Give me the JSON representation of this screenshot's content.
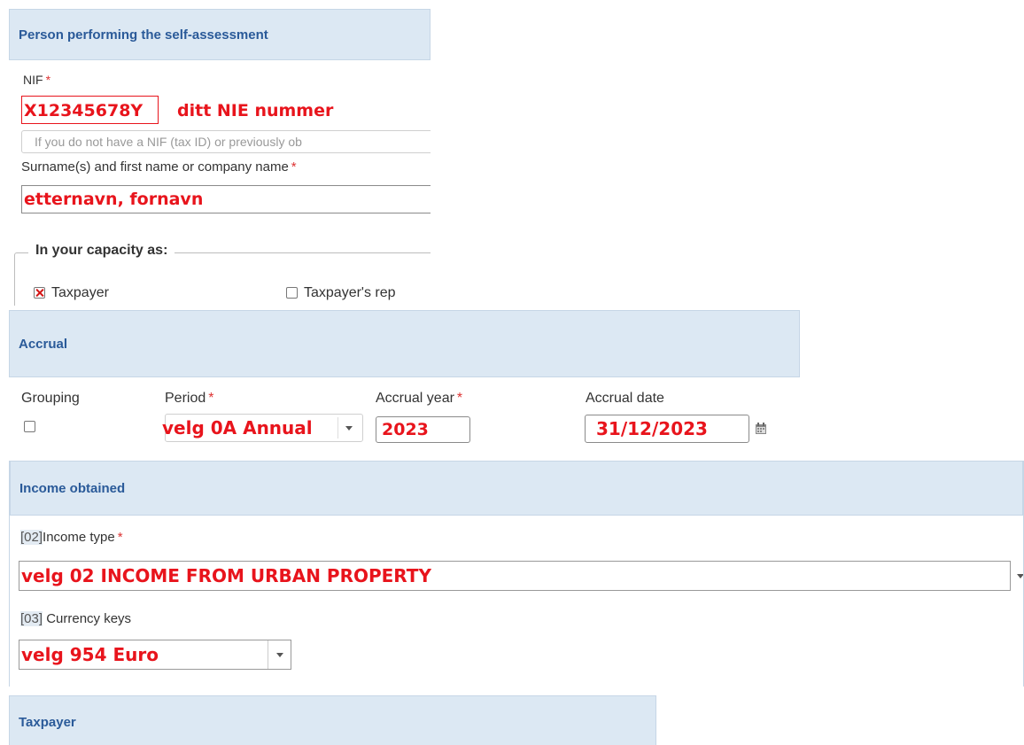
{
  "person_section": {
    "title": "Person performing the self-assessment",
    "nif_label": "NIF",
    "nif_value": "X12345678Y",
    "nif_note": "ditt NIE nummer",
    "nif_hint": "If you do not have a NIF (tax ID) or previously ob",
    "name_label": "Surname(s) and first name or company name",
    "name_value": "etternavn, fornavn",
    "capacity_legend": "In your capacity as:",
    "taxpayer_label": "Taxpayer",
    "taxpayer_checked": true,
    "representative_label": "Taxpayer's rep",
    "representative_checked": false
  },
  "accrual_section": {
    "title": "Accrual",
    "grouping_label": "Grouping",
    "period_label": "Period",
    "period_value": "velg 0A Annual",
    "year_label": "Accrual year",
    "year_value": "2023",
    "date_label": "Accrual date",
    "date_value": "31/12/2023"
  },
  "income_section": {
    "title": "Income obtained",
    "income_type_code": "[02]",
    "income_type_label": "Income type",
    "income_type_value": "velg  02 INCOME FROM URBAN PROPERTY",
    "currency_code": "[03]",
    "currency_label": " Currency keys",
    "currency_value": "velg  954 Euro"
  },
  "taxpayer_section": {
    "title": "Taxpayer"
  },
  "required_marker": "*",
  "colors": {
    "header_bg": "#dce8f3",
    "header_text": "#2a5a99",
    "annotation_red": "#e8141c"
  },
  "icons": {
    "calendar": "calendar-icon",
    "dropdown": "chevron-down-icon",
    "checkbox_checked": "checkbox-checked-icon"
  }
}
